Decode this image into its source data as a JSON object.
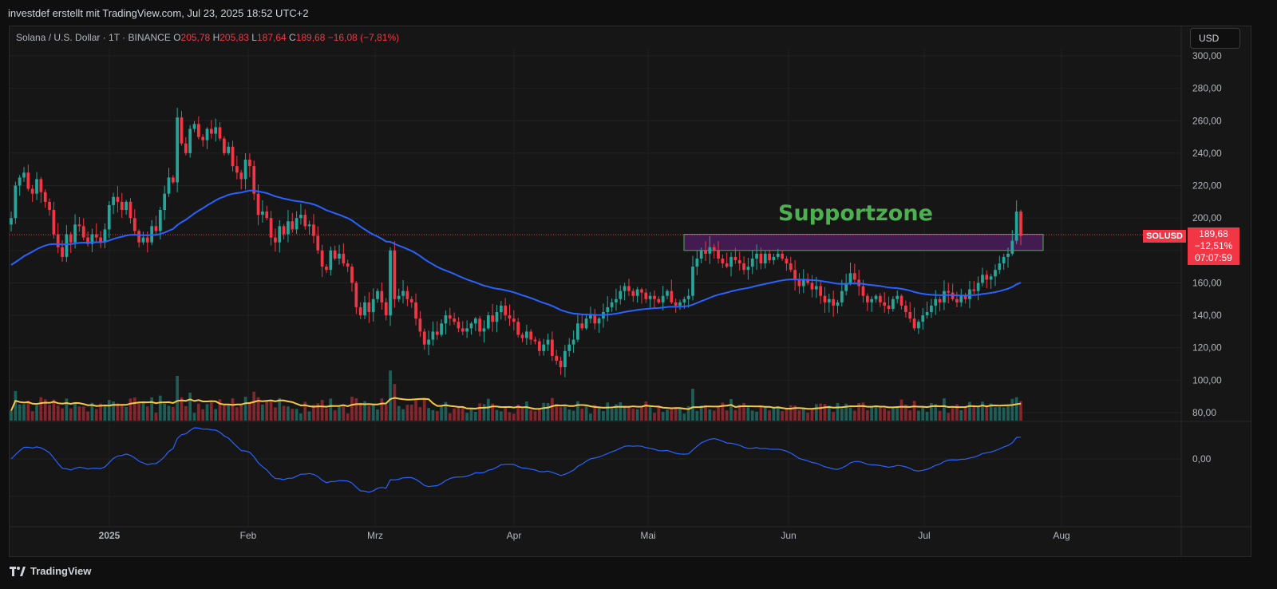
{
  "header": {
    "credit": "investdef erstellt mit TradingView.com, Jul 23, 2025 18:52 UTC+2"
  },
  "legend": {
    "symbol": "Solana / U.S. Dollar · 1T · BINANCE",
    "o_label": "O",
    "o_value": "205,78",
    "h_label": "H",
    "h_value": "205,83",
    "l_label": "L",
    "l_value": "187,64",
    "c_label": "C",
    "c_value": "189,68",
    "change": "−16,08 (−7,81%)"
  },
  "currency_button": "USD",
  "annotation": "Supportzone",
  "price_axis": [
    "300,00",
    "280,00",
    "260,00",
    "240,00",
    "220,00",
    "200,00",
    "180,00",
    "160,00",
    "140,00",
    "120,00",
    "100,00",
    "80,00"
  ],
  "osc_axis": [
    "0,00"
  ],
  "time_axis": [
    "2025",
    "Feb",
    "Mrz",
    "Apr",
    "Mai",
    "Jun",
    "Jul",
    "Aug"
  ],
  "last_price": {
    "symbol": "SOLUSD",
    "price": "189,68",
    "change": "−12,51%",
    "countdown": "07:07:59"
  },
  "footer": {
    "brand": "TradingView"
  },
  "colors": {
    "up": "#26a69a",
    "down": "#f23645",
    "ma_blue": "#2962ff",
    "vol_ma": "#f7c948",
    "zone_fill": "#4a1d5a",
    "zone_border": "#4caf50",
    "annotation": "#4caf50",
    "osc": "#2962ff"
  },
  "chart_data": {
    "type": "candlestick",
    "y_range": [
      75,
      305
    ],
    "closes": [
      200,
      220,
      225,
      228,
      218,
      215,
      224,
      216,
      210,
      205,
      190,
      182,
      176,
      190,
      185,
      196,
      195,
      188,
      184,
      190,
      188,
      185,
      193,
      208,
      213,
      210,
      205,
      210,
      200,
      192,
      185,
      188,
      185,
      195,
      192,
      205,
      215,
      225,
      222,
      262,
      246,
      240,
      255,
      258,
      250,
      248,
      255,
      252,
      256,
      249,
      240,
      244,
      232,
      228,
      224,
      236,
      232,
      215,
      202,
      204,
      200,
      188,
      185,
      195,
      190,
      198,
      193,
      200,
      202,
      195,
      196,
      189,
      180,
      170,
      168,
      180,
      175,
      178,
      172,
      170,
      160,
      145,
      140,
      148,
      142,
      150,
      155,
      148,
      140,
      180,
      150,
      152,
      155,
      150,
      148,
      138,
      130,
      122,
      125,
      130,
      128,
      135,
      140,
      138,
      136,
      132,
      130,
      132,
      135,
      138,
      130,
      132,
      140,
      136,
      142,
      146,
      140,
      138,
      136,
      128,
      126,
      130,
      125,
      124,
      118,
      122,
      125,
      115,
      112,
      108,
      118,
      122,
      125,
      135,
      132,
      138,
      140,
      135,
      138,
      142,
      145,
      148,
      150,
      155,
      158,
      155,
      152,
      156,
      154,
      150,
      152,
      150,
      148,
      152,
      155,
      148,
      146,
      148,
      150,
      152,
      170,
      175,
      180,
      178,
      182,
      180,
      175,
      172,
      170,
      176,
      174,
      172,
      168,
      170,
      175,
      178,
      172,
      178,
      174,
      176,
      178,
      175,
      172,
      168,
      162,
      158,
      162,
      160,
      156,
      158,
      152,
      148,
      150,
      146,
      148,
      155,
      160,
      166,
      162,
      158,
      152,
      148,
      150,
      152,
      148,
      146,
      144,
      150,
      152,
      146,
      142,
      138,
      132,
      136,
      140,
      142,
      146,
      150,
      148,
      155,
      154,
      150,
      148,
      152,
      150,
      156,
      155,
      160,
      165,
      162,
      164,
      168,
      172,
      176,
      178,
      186,
      204,
      189
    ],
    "ma200_note": "blue moving average",
    "annotation": "Supportzone",
    "zone": [
      180,
      188
    ],
    "last_close": 189.68
  }
}
